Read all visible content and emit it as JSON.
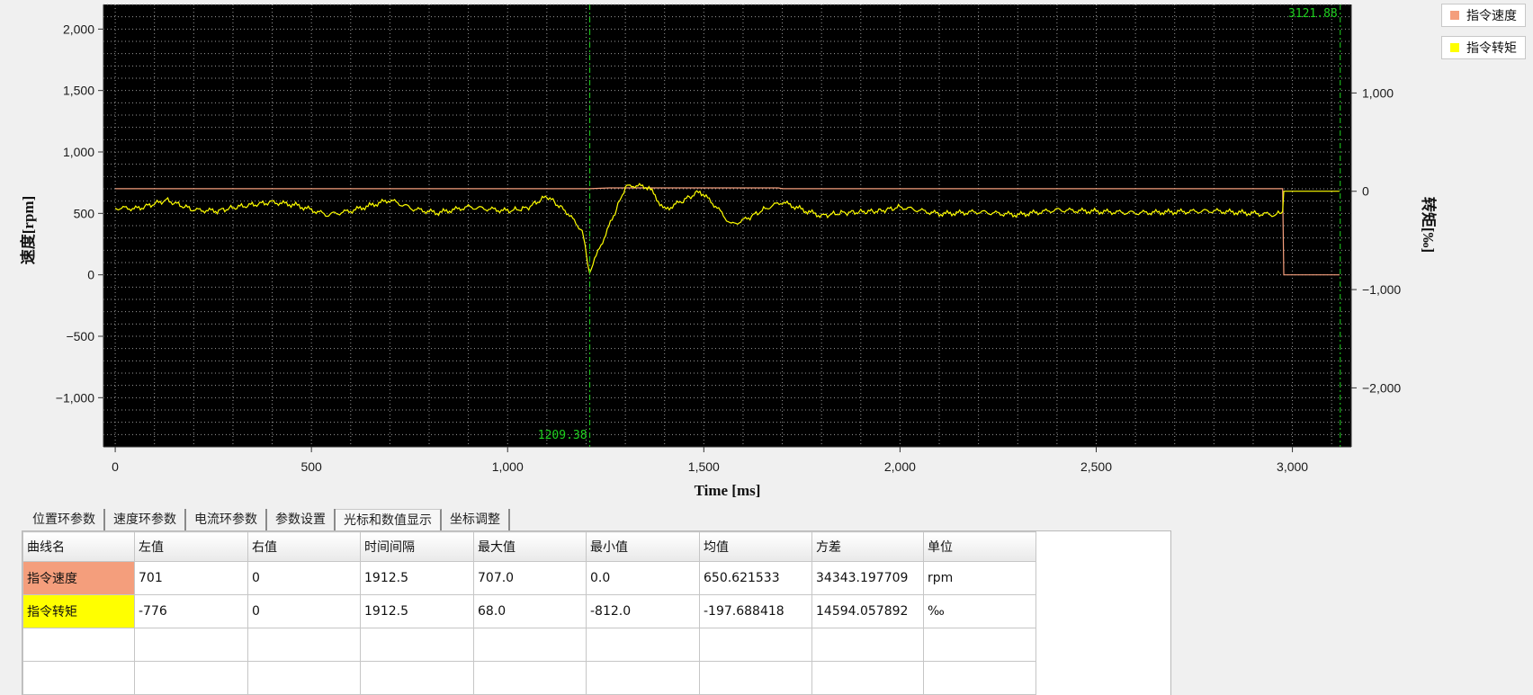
{
  "legend": [
    {
      "label": "指令速度",
      "color": "#f49e7c"
    },
    {
      "label": "指令转矩",
      "color": "#ffff00"
    }
  ],
  "tabs": [
    {
      "label": "位置环参数"
    },
    {
      "label": "速度环参数"
    },
    {
      "label": "电流环参数"
    },
    {
      "label": "参数设置"
    },
    {
      "label": "光标和数值显示",
      "active": true
    },
    {
      "label": "坐标调整"
    }
  ],
  "table": {
    "headers": [
      "曲线名",
      "左值",
      "右值",
      "时间间隔",
      "最大值",
      "最小值",
      "均值",
      "方差",
      "单位"
    ],
    "rows": [
      {
        "name": "指令速度",
        "color": "#f49e7c",
        "cells": [
          "701",
          "0",
          "1912.5",
          "707.0",
          "0.0",
          "650.621533",
          "34343.197709",
          "rpm"
        ]
      },
      {
        "name": "指令转矩",
        "color": "#ffff00",
        "cells": [
          "-776",
          "0",
          "1912.5",
          "68.0",
          "-812.0",
          "-197.688418",
          "14594.057892",
          "‰"
        ]
      }
    ]
  },
  "chart_data": {
    "type": "line",
    "xlabel": "Time [ms]",
    "ylabel": "速度[rpm]",
    "y2label": "转矩[‰]",
    "xlim": [
      -30,
      3150
    ],
    "ylim": [
      -1400,
      2200
    ],
    "y2lim": [
      -2600,
      1900
    ],
    "xticks": [
      0,
      500,
      1000,
      1500,
      2000,
      2500,
      3000
    ],
    "xtick_labels": [
      "0",
      "500",
      "1,000",
      "1,500",
      "2,000",
      "2,500",
      "3,000"
    ],
    "yticks": [
      2000,
      1500,
      1000,
      500,
      0,
      -500,
      -1000
    ],
    "ytick_labels": [
      "2,000",
      "1,500",
      "1,000",
      "500",
      "0",
      "−500",
      "−1,000"
    ],
    "y2ticks": [
      1000,
      0,
      -1000,
      -2000
    ],
    "y2tick_labels": [
      "1,000",
      "0",
      "−1,000",
      "−2,000"
    ],
    "grid": true,
    "background": "#000000",
    "legend_position": "right",
    "cursors": [
      {
        "x": 1209.38,
        "label": "1209.38",
        "label_position": "bottom"
      },
      {
        "x": 3121.88,
        "label": "3121.88",
        "label_position": "top"
      }
    ],
    "series": [
      {
        "name": "指令速度",
        "axis": "left",
        "color": "#f49e7c",
        "x": [
          0,
          1209,
          1260,
          1690,
          1700,
          2975,
          2978,
          3120
        ],
        "values": [
          701,
          701,
          707,
          707,
          701,
          701,
          0,
          0
        ]
      },
      {
        "name": "指令转矩",
        "axis": "right",
        "color": "#ffff00",
        "x": [
          0,
          60,
          130,
          200,
          260,
          310,
          400,
          460,
          540,
          600,
          700,
          760,
          820,
          900,
          1000,
          1050,
          1100,
          1150,
          1190,
          1209,
          1230,
          1270,
          1300,
          1320,
          1360,
          1400,
          1440,
          1490,
          1530,
          1570,
          1610,
          1660,
          1700,
          1760,
          1800,
          1850,
          1900,
          1950,
          2000,
          2100,
          2200,
          2300,
          2400,
          2600,
          2800,
          2960,
          2975,
          2978,
          3120
        ],
        "values": [
          -170,
          -175,
          -90,
          -190,
          -200,
          -160,
          -110,
          -140,
          -240,
          -200,
          -90,
          -180,
          -220,
          -160,
          -200,
          -170,
          -50,
          -210,
          -400,
          -830,
          -620,
          -250,
          40,
          60,
          40,
          -190,
          -110,
          0,
          -150,
          -340,
          -280,
          -170,
          -110,
          -200,
          -250,
          -220,
          -210,
          -200,
          -160,
          -230,
          -210,
          -240,
          -190,
          -220,
          -200,
          -240,
          -200,
          0,
          0
        ]
      }
    ]
  }
}
